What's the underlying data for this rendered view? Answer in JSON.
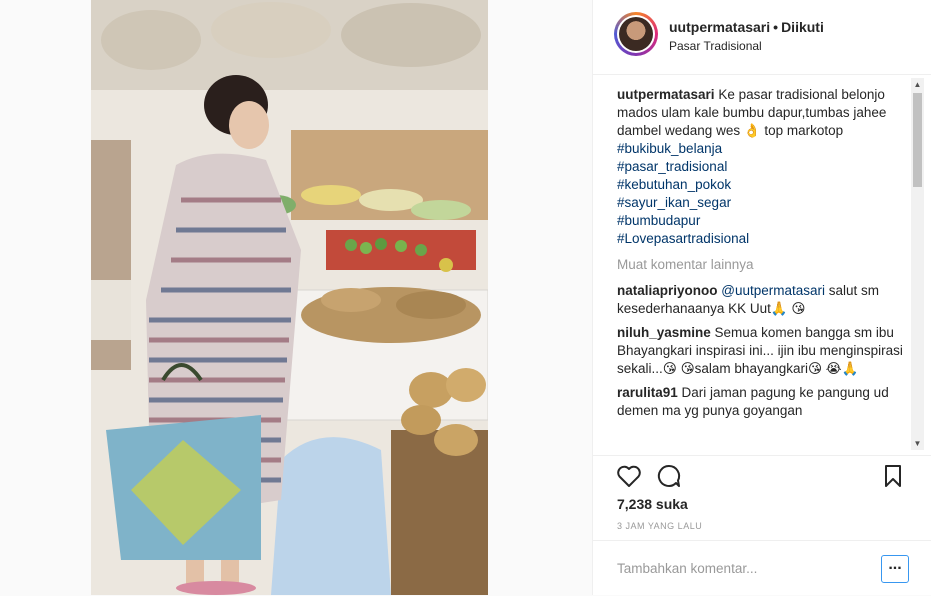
{
  "post": {
    "username": "uutpermatasari",
    "follow_status": "Diikuti",
    "location": "Pasar Tradisional",
    "caption": {
      "username": "uutpermatasari",
      "text": "Ke pasar tradisional belonjo mados ulam kale bumbu dapur,tumbas jahee dambel wedang wes 👌 top markotop",
      "hashtags": [
        "#bukibuk_belanja",
        "#pasar_tradisional",
        "#kebutuhan_pokok",
        "#sayur_ikan_segar",
        "#bumbudapur",
        "#Lovepasartradisional"
      ]
    },
    "load_more": "Muat komentar lainnya",
    "comments": [
      {
        "username": "nataliapriyonoo",
        "mention": "@uutpermatasari",
        "text": " salut sm kesederhanaanya KK Uut🙏 😘"
      },
      {
        "username": "niluh_yasmine",
        "mention": "",
        "text": " Semua komen bangga sm ibu Bhayangkari inspirasi ini... ijin ibu menginspirasi sekali...😘 😘salam bhayangkari😘 😭🙏"
      },
      {
        "username": "rarulita91",
        "mention": "",
        "text": " Dari jaman pagung ke pangung ud demen ma yg punya goyangan"
      }
    ],
    "likes": "7,238 suka",
    "timestamp": "3 JAM YANG LALU",
    "add_comment_placeholder": "Tambahkan komentar...",
    "more_options": "..."
  },
  "icons": [
    "heart-icon",
    "comment-icon",
    "bookmark-icon"
  ],
  "colors": {
    "link": "#003569",
    "muted": "#999999",
    "accent": "#3897f0"
  }
}
